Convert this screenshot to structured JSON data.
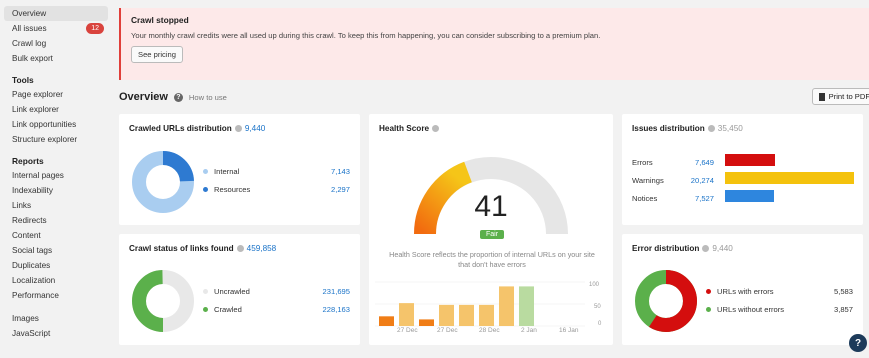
{
  "sidebar": {
    "top_items": [
      {
        "label": "Overview",
        "active": true
      },
      {
        "label": "All issues",
        "badge": "12"
      },
      {
        "label": "Crawl log"
      },
      {
        "label": "Bulk export"
      }
    ],
    "tools_heading": "Tools",
    "tools": [
      "Page explorer",
      "Link explorer",
      "Link opportunities",
      "Structure explorer"
    ],
    "reports_heading": "Reports",
    "reports": [
      "Internal pages",
      "Indexability",
      "Links",
      "Redirects",
      "Content",
      "Social tags",
      "Duplicates",
      "Localization",
      "Performance"
    ],
    "more": [
      "Images",
      "JavaScript"
    ]
  },
  "alert": {
    "title": "Crawl stopped",
    "text": "Your monthly crawl credits were all used up during this crawl. To keep this from happening, you can consider subscribing to a premium plan.",
    "button": "See pricing"
  },
  "overview": {
    "title": "Overview",
    "howto": "How to use",
    "print": "Print to PDF"
  },
  "crawled_urls": {
    "title": "Crawled URLs distribution",
    "total": "9,440",
    "items": [
      {
        "label": "Internal",
        "value": "7,143",
        "color": "#a9cdf0"
      },
      {
        "label": "Resources",
        "value": "2,297",
        "color": "#2e7ad1"
      }
    ]
  },
  "crawl_status": {
    "title": "Crawl status of links found",
    "total": "459,858",
    "items": [
      {
        "label": "Uncrawled",
        "value": "231,695",
        "color": "#e8e8e8"
      },
      {
        "label": "Crawled",
        "value": "228,163",
        "color": "#5bb04b"
      }
    ]
  },
  "health": {
    "title": "Health Score",
    "score": "41",
    "rating": "Fair",
    "description": "Health Score reflects the proportion of internal URLs on your site that don't have errors",
    "x_ticks": [
      "27 Dec",
      "27 Dec",
      "28 Dec",
      "2 Jan",
      "16 Jan"
    ],
    "y_ticks": [
      "100",
      "50",
      "0"
    ],
    "bars": [
      {
        "value": 22,
        "color": "#f07d16"
      },
      {
        "value": 52,
        "color": "#f5c46b"
      },
      {
        "value": 15,
        "color": "#f07d16"
      },
      {
        "value": 48,
        "color": "#f5c46b"
      },
      {
        "value": 48,
        "color": "#f5c46b"
      },
      {
        "value": 48,
        "color": "#f5c46b"
      },
      {
        "value": 90,
        "color": "#f5c46b"
      },
      {
        "value": 90,
        "color": "#b9dba0"
      }
    ]
  },
  "issues": {
    "title": "Issues distribution",
    "total": "35,450",
    "items": [
      {
        "label": "Errors",
        "value": "7,649",
        "color": "#d40e0e",
        "share": 0.216
      },
      {
        "label": "Warnings",
        "value": "20,274",
        "color": "#f4c20d",
        "share": 0.572
      },
      {
        "label": "Notices",
        "value": "7,527",
        "color": "#2e86de",
        "share": 0.212
      }
    ]
  },
  "errors": {
    "title": "Error distribution",
    "total": "9,440",
    "items": [
      {
        "label": "URLs with errors",
        "value": "5,583",
        "color": "#d40e0e"
      },
      {
        "label": "URLs without errors",
        "value": "3,857",
        "color": "#5bb04b"
      }
    ]
  },
  "fab": "?"
}
